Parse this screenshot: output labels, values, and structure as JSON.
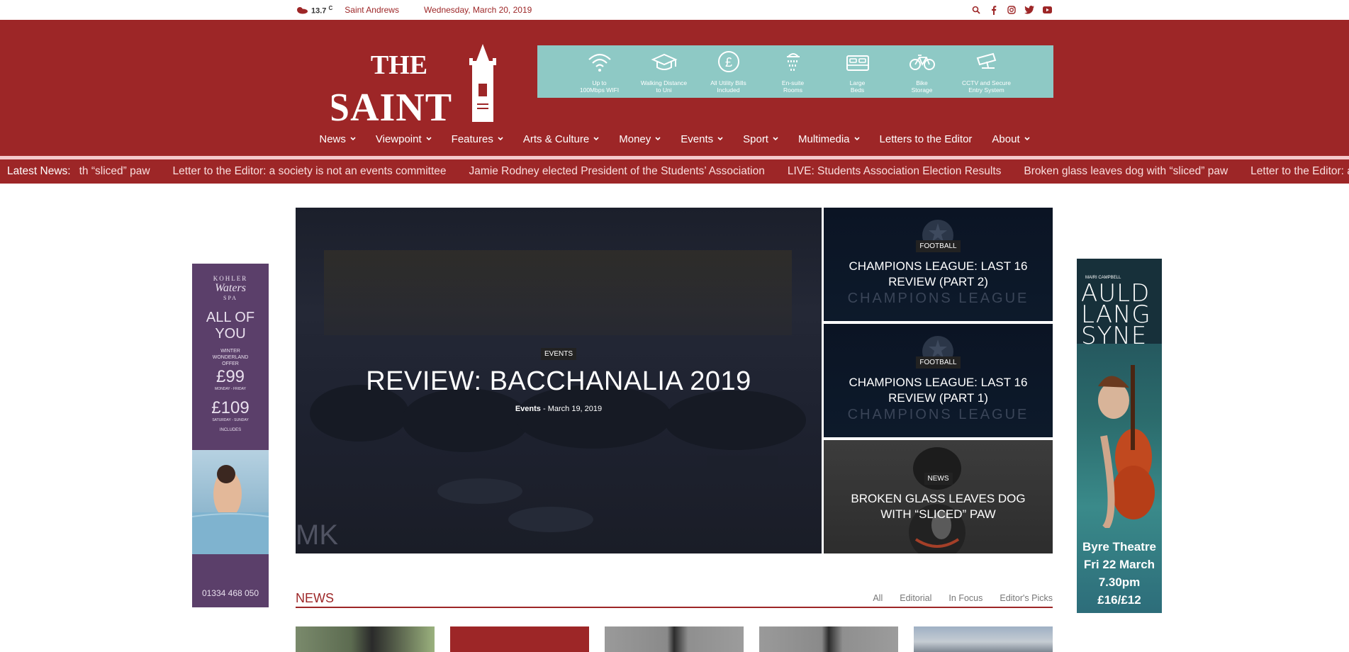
{
  "topbar": {
    "temperature": "13.7",
    "unit": "C",
    "location": "Saint Andrews",
    "date": "Wednesday, March 20, 2019",
    "social_icons": [
      "search-icon",
      "facebook-icon",
      "instagram-icon",
      "twitter-icon",
      "youtube-icon"
    ]
  },
  "logo": {
    "line1": "THE",
    "line2": "SAINT"
  },
  "amenities": [
    {
      "icon": "wifi-icon",
      "line1": "Up to",
      "line2": "100Mbps WIFI"
    },
    {
      "icon": "graduation-cap-icon",
      "line1": "Walking Distance",
      "line2": "to Uni"
    },
    {
      "icon": "pound-icon",
      "line1": "All Utility Bills",
      "line2": "Included"
    },
    {
      "icon": "shower-icon",
      "line1": "En-suite",
      "line2": "Rooms"
    },
    {
      "icon": "bed-icon",
      "line1": "Large",
      "line2": "Beds"
    },
    {
      "icon": "bike-icon",
      "line1": "Bike",
      "line2": "Storage"
    },
    {
      "icon": "cctv-icon",
      "line1": "CCTV and Secure",
      "line2": "Entry System"
    }
  ],
  "nav": [
    {
      "label": "News",
      "dropdown": true
    },
    {
      "label": "Viewpoint",
      "dropdown": true
    },
    {
      "label": "Features",
      "dropdown": true
    },
    {
      "label": "Arts & Culture",
      "dropdown": true
    },
    {
      "label": "Money",
      "dropdown": true
    },
    {
      "label": "Events",
      "dropdown": true
    },
    {
      "label": "Sport",
      "dropdown": true
    },
    {
      "label": "Multimedia",
      "dropdown": true
    },
    {
      "label": "Letters to the Editor",
      "dropdown": false
    },
    {
      "label": "About",
      "dropdown": true
    }
  ],
  "ticker": {
    "label": "Latest News:",
    "items": [
      "th “sliced” paw",
      "Letter to the Editor: a society is not an events committee",
      "Jamie Rodney elected President of the Students’ Association",
      "LIVE: Students Association Election Results",
      "Broken glass leaves dog with “sliced” paw",
      "Letter to the Editor: a"
    ]
  },
  "featured": {
    "main": {
      "category": "EVENTS",
      "title": "REVIEW: BACCHANALIA 2019",
      "meta_category": "Events",
      "meta_date": "March 19, 2019",
      "watermark": "MK"
    },
    "side": [
      {
        "category": "FOOTBALL",
        "title": "CHAMPIONS LEAGUE: LAST 16 REVIEW (PART 2)",
        "watermark": "CHAMPIONS LEAGUE"
      },
      {
        "category": "FOOTBALL",
        "title": "CHAMPIONS LEAGUE: LAST 16 REVIEW (PART 1)",
        "watermark": "CHAMPIONS LEAGUE"
      },
      {
        "category": "NEWS",
        "title": "BROKEN GLASS LEAVES DOG WITH “SLICED” PAW",
        "watermark": ""
      }
    ]
  },
  "ad_left": {
    "brand1": "KOHLER",
    "brand2": "Waters",
    "brand3": "SPA",
    "headline": "ALL OF YOU",
    "offer": "WINTER WONDERLAND OFFER",
    "price1": "£99",
    "price1_note": "MONDAY - FRIDAY",
    "price2": "£109",
    "price2_note": "SATURDAY - SUNDAY",
    "includes": "INCLUDES",
    "phone": "01334 468 050"
  },
  "ad_right": {
    "artist": "MAIRI CAMPBELL",
    "title_lines": [
      "AULD",
      "LANG",
      "SYNE"
    ],
    "venue": "Byre Theatre",
    "when": "Fri 22 March",
    "time": "7.30pm",
    "price": "£16/£12"
  },
  "news": {
    "title": "NEWS",
    "filters": [
      "All",
      "Editorial",
      "In Focus",
      "Editor's Picks"
    ]
  },
  "colors": {
    "brand": "#9d2627",
    "amenities_bg": "#8ec9c5",
    "ticker_border": "#f4c9cb"
  }
}
